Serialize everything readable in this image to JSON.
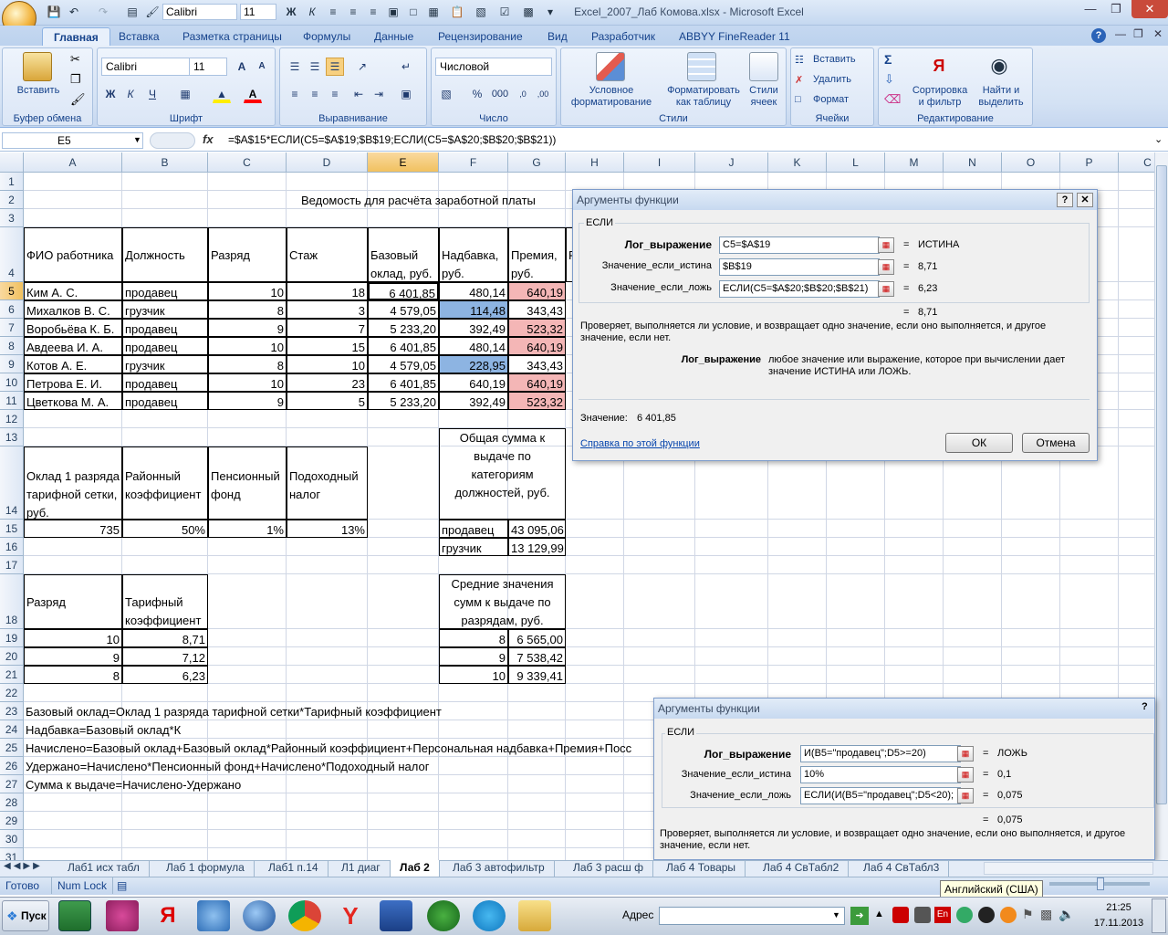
{
  "window": {
    "title": "Excel_2007_Лаб Комова.xlsx - Microsoft Excel",
    "qat_font": "Calibri",
    "qat_size": "11"
  },
  "ribbon_tabs": [
    "Главная",
    "Вставка",
    "Разметка страницы",
    "Формулы",
    "Данные",
    "Рецензирование",
    "Вид",
    "Разработчик",
    "ABBYY FineReader 11"
  ],
  "ribbon": {
    "paste": "Вставить",
    "clipboard": "Буфер обмена",
    "font_name": "Calibri",
    "font_size": "11",
    "font_group": "Шрифт",
    "bold": "Ж",
    "italic": "К",
    "underline": "Ч",
    "grow": "A",
    "align_group": "Выравнивание",
    "number_format": "Числовой",
    "number_group": "Число",
    "percent": "%",
    "thousands": "000",
    "cond_format_1": "Условное",
    "cond_format_2": "форматирование",
    "format_table_1": "Форматировать",
    "format_table_2": "как таблицу",
    "cell_styles_1": "Стили",
    "cell_styles_2": "ячеек",
    "styles_group": "Стили",
    "insert": "Вставить",
    "delete": "Удалить",
    "format": "Формат",
    "cells_group": "Ячейки",
    "sort_1": "Сортировка",
    "sort_2": "и фильтр",
    "find_1": "Найти и",
    "find_2": "выделить",
    "editing_group": "Редактирование",
    "sum": "Σ"
  },
  "formula_bar": {
    "name_box": "E5",
    "fx": "fx",
    "formula": "=$A$15*ЕСЛИ(C5=$A$19;$B$19;ЕСЛИ(C5=$A$20;$B$20;$B$21))"
  },
  "columns": [
    "A",
    "B",
    "C",
    "D",
    "E",
    "F",
    "G",
    "H",
    "I",
    "J",
    "K",
    "L",
    "M",
    "N",
    "O",
    "P",
    "C"
  ],
  "rows": [
    "1",
    "2",
    "3",
    "4",
    "5",
    "6",
    "7",
    "8",
    "9",
    "10",
    "11",
    "12",
    "13",
    "14",
    "15",
    "16",
    "17",
    "18",
    "19",
    "20",
    "21",
    "22",
    "23",
    "24",
    "25",
    "26",
    "27",
    "28",
    "29",
    "30",
    "31"
  ],
  "sheet": {
    "title": "Ведомость для расчёта заработной платы",
    "headers": [
      "ФИО работника",
      "Должность",
      "Разряд",
      "Стаж",
      "Базовый оклад, руб.",
      "Надбавка, руб.",
      "Премия, руб.",
      "Р"
    ],
    "employees": [
      [
        "Ким А. С.",
        "продавец",
        "10",
        "18",
        "6 401,85",
        "480,14",
        "640,19"
      ],
      [
        "Михалков В. С.",
        "грузчик",
        "8",
        "3",
        "4 579,05",
        "114,48",
        "343,43"
      ],
      [
        "Воробьёва К. Б.",
        "продавец",
        "9",
        "7",
        "5 233,20",
        "392,49",
        "523,32"
      ],
      [
        "Авдеева И. А.",
        "продавец",
        "10",
        "15",
        "6 401,85",
        "480,14",
        "640,19"
      ],
      [
        "Котов А. Е.",
        "грузчик",
        "8",
        "10",
        "4 579,05",
        "228,95",
        "343,43"
      ],
      [
        "Петрова Е. И.",
        "продавец",
        "10",
        "23",
        "6 401,85",
        "640,19",
        "640,19"
      ],
      [
        "Цветкова М. А.",
        "продавец",
        "9",
        "5",
        "5 233,20",
        "392,49",
        "523,32"
      ]
    ],
    "params_headers": [
      "Оклад 1 разряда тарифной сетки, руб.",
      "Районный коэффициент",
      "Пенсионный фонд",
      "Подоходный налог"
    ],
    "params_values": [
      "735",
      "50%",
      "1%",
      "13%"
    ],
    "totals_header": "Общая сумма к выдаче по категориям должностей, руб.",
    "totals": [
      [
        "продавец",
        "43 095,06"
      ],
      [
        "грузчик",
        "13 129,99"
      ]
    ],
    "tariff_headers": [
      "Разряд",
      "Тарифный коэффициент"
    ],
    "tariff": [
      [
        "10",
        "8,71"
      ],
      [
        "9",
        "7,12"
      ],
      [
        "8",
        "6,23"
      ]
    ],
    "avg_header": "Средние значения сумм к выдаче по разрядам, руб.",
    "avg": [
      [
        "8",
        "6 565,00"
      ],
      [
        "9",
        "7 538,42"
      ],
      [
        "10",
        "9 339,41"
      ]
    ],
    "notes": [
      "Базовый оклад=Оклад 1 разряда тарифной сетки*Тарифный коэффициент",
      "Надбавка=Базовый оклад*К",
      "Начислено=Базовый оклад+Базовый оклад*Районный коэффициент+Персональная надбавка+Премия+Посс",
      "Удержано=Начислено*Пенсионный фонд+Начислено*Подоходный налог",
      "Сумма к выдаче=Начислено-Удержано"
    ]
  },
  "dialog1": {
    "title": "Аргументы функции",
    "help": "?",
    "close": "✕",
    "func": "ЕСЛИ",
    "args": [
      {
        "label": "Лог_выражение",
        "value": "C5=$A$19",
        "result": "ИСТИНА"
      },
      {
        "label": "Значение_если_истина",
        "value": "$B$19",
        "result": "8,71"
      },
      {
        "label": "Значение_если_ложь",
        "value": "ЕСЛИ(C5=$A$20;$B$20;$B$21)",
        "result": "6,23"
      }
    ],
    "eq": "=",
    "total": "8,71",
    "description": "Проверяет, выполняется ли условие, и возвращает одно значение, если оно выполняется, и другое значение, если нет.",
    "arg_name": "Лог_выражение",
    "arg_desc": "любое значение или выражение, которое при вычислении дает значение ИСТИНА или ЛОЖЬ.",
    "value_label": "Значение:",
    "value": "6 401,85",
    "help_link": "Справка по этой функции",
    "ok": "ОК",
    "cancel": "Отмена"
  },
  "dialog2": {
    "title": "Аргументы функции",
    "help": "?",
    "func": "ЕСЛИ",
    "args": [
      {
        "label": "Лог_выражение",
        "value": "И(B5=\"продавец\";D5>=20)",
        "result": "ЛОЖЬ"
      },
      {
        "label": "Значение_если_истина",
        "value": "10%",
        "result": "0,1"
      },
      {
        "label": "Значение_если_ложь",
        "value": "ЕСЛИ(И(B5=\"продавец\";D5<20);",
        "result": "0,075"
      }
    ],
    "eq": "=",
    "total": "0,075",
    "description": "Проверяет, выполняется ли условие, и возвращает одно значение, если оно выполняется, и другое значение, если нет."
  },
  "sheet_tabs": [
    "Лаб1 исх табл",
    "Лаб 1 формула",
    "Лаб1 п.14",
    "Л1 диаг",
    "Лаб 2",
    "Лаб 3 автофильтр",
    "Лаб 3 расш ф",
    "Лаб 4 Товары",
    "Лаб 4 СвТабл2",
    "Лаб 4 СвТабл3"
  ],
  "status": {
    "ready": "Готово",
    "numlock": "Num Lock",
    "tooltip": "Английский (США)"
  },
  "taskbar": {
    "start": "Пуск",
    "address_label": "Адрес",
    "lang": "En",
    "time": "21:25",
    "date": "17.11.2013"
  }
}
